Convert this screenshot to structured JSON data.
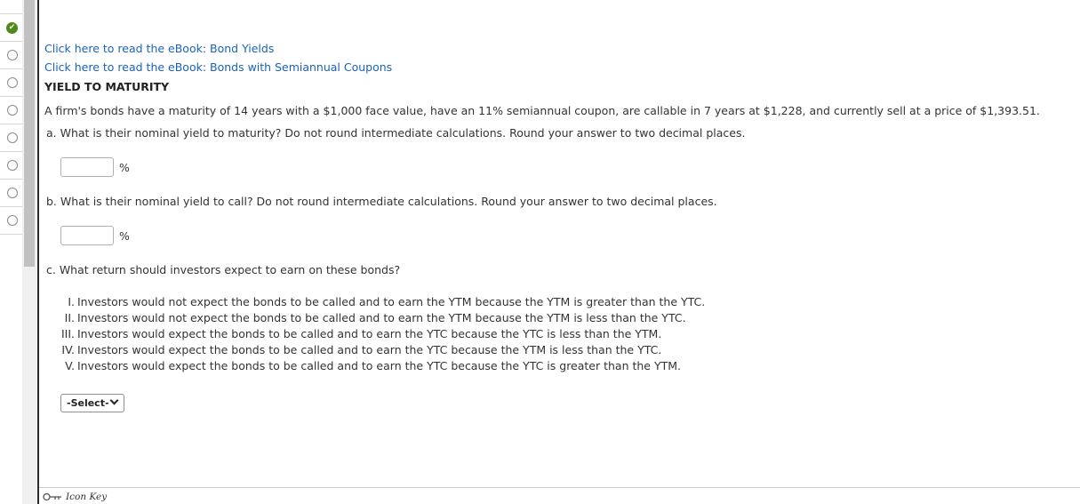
{
  "nav": {
    "items": [
      {
        "state": "answered"
      },
      {
        "state": "unanswered"
      },
      {
        "state": "unanswered"
      },
      {
        "state": "unanswered"
      },
      {
        "state": "unanswered"
      },
      {
        "state": "unanswered"
      },
      {
        "state": "unanswered"
      },
      {
        "state": "unanswered"
      }
    ],
    "colors": {
      "check": "#4e8a19",
      "circle_border": "#8a8a8a"
    }
  },
  "links": {
    "ebook1": "Click here to read the eBook: Bond Yields",
    "ebook2": "Click here to read the eBook: Bonds with Semiannual Coupons",
    "color": "#1a63b8"
  },
  "question": {
    "title": "YIELD TO MATURITY",
    "stem": "A firm's bonds have a maturity of 14 years with a $1,000 face value, have an 11% semiannual coupon, are callable in 7 years at $1,228, and currently sell at a price of $1,393.51.",
    "part_a": {
      "text": "a. What is their nominal yield to maturity? Do not round intermediate calculations. Round your answer to two decimal places.",
      "value": "",
      "unit": "%"
    },
    "part_b": {
      "text": "b. What is their nominal yield to call? Do not round intermediate calculations. Round your answer to two decimal places.",
      "value": "",
      "unit": "%"
    },
    "part_c": {
      "text": "c. What return should investors expect to earn on these bonds?",
      "options": [
        {
          "num": "I.",
          "text": "Investors would not expect the bonds to be called and to earn the YTM because the YTM is greater than the YTC."
        },
        {
          "num": "II.",
          "text": "Investors would not expect the bonds to be called and to earn the YTM because the YTM is less than the YTC."
        },
        {
          "num": "III.",
          "text": "Investors would expect the bonds to be called and to earn the YTC because the YTC is less than the YTM."
        },
        {
          "num": "IV.",
          "text": "Investors would expect the bonds to be called and to earn the YTC because the YTM is less than the YTC."
        },
        {
          "num": "V.",
          "text": "Investors would expect the bonds to be called and to earn the YTC because the YTC is greater than the YTM."
        }
      ],
      "select_label": "-Select-"
    }
  },
  "footer": {
    "icon_key_label": "Icon Key"
  }
}
